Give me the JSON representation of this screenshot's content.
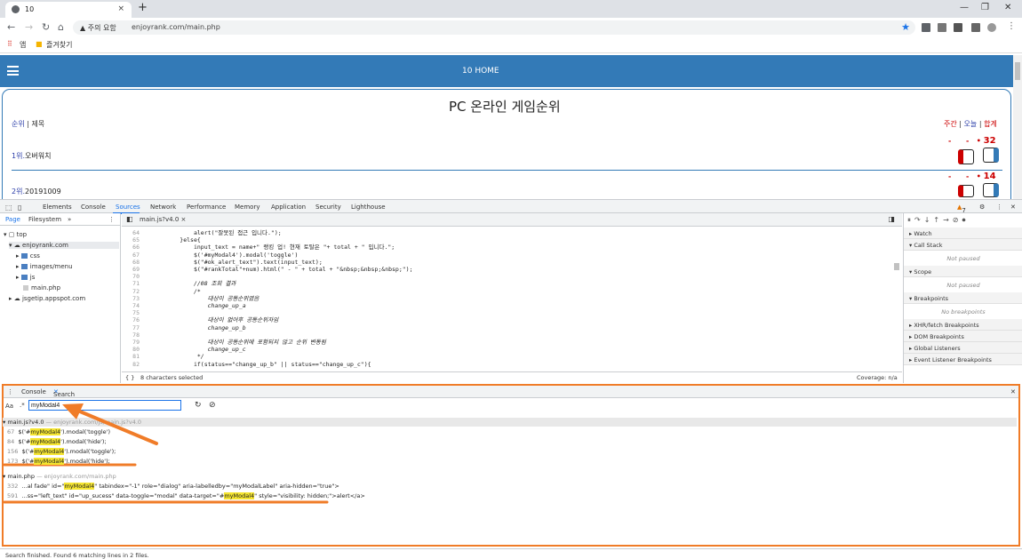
{
  "browser": {
    "tab_title": "10",
    "tab_close": "×",
    "new_tab": "+",
    "security_label": "주의 요함",
    "url": "enjoyrank.com/main.php",
    "bookmarks": [
      "앱",
      "즐겨찾기"
    ]
  },
  "page": {
    "header_title": "10 HOME",
    "title": "PC 온라인 게임순위",
    "col_rank": "순위",
    "col_sep": "|",
    "col_title": "제목",
    "filter_weekly": "주간",
    "filter_today": "오늘",
    "filter_total": "합계",
    "rows": [
      {
        "rank": "1위.",
        "name": "오버워치",
        "up": "-",
        "mid": "-",
        "total": "32"
      },
      {
        "rank": "2위.",
        "name": "20191009",
        "up": "-",
        "mid": "-",
        "total": "14"
      }
    ]
  },
  "devtools": {
    "tabs": [
      "Elements",
      "Console",
      "Sources",
      "Network",
      "Performance",
      "Memory",
      "Application",
      "Security",
      "Lighthouse"
    ],
    "active_tab": "Sources",
    "warning_count": "7",
    "nav_tabs": [
      "Page",
      "Filesystem"
    ],
    "tree": [
      "top",
      "enjoyrank.com",
      "css",
      "images/menu",
      "js",
      "main.php",
      "jsgetip.appspot.com"
    ],
    "editor_file": "main.js?v4.0",
    "code_lines": [
      {
        "n": "64",
        "t": "            alert(\"잘못된 접근 입니다.\");"
      },
      {
        "n": "65",
        "t": "        }else{"
      },
      {
        "n": "66",
        "t": "            input_text = name+\" 랭킹 업! 현재 토탈은 \"+ total + \" 입니다.\";"
      },
      {
        "n": "67",
        "t": "            $('#myModal4').modal('toggle')"
      },
      {
        "n": "68",
        "t": "            $(\"#ok_alert_text\").text(input_text);"
      },
      {
        "n": "69",
        "t": "            $(\"#rankTotal\"+num).html(\" - \" + total + \"&nbsp;&nbsp;&nbsp;\");"
      },
      {
        "n": "70",
        "t": ""
      },
      {
        "n": "71",
        "t": "            //08 조회 결과"
      },
      {
        "n": "72",
        "t": "            /*"
      },
      {
        "n": "73",
        "t": "                대상이 공동순위였음"
      },
      {
        "n": "74",
        "t": "                change_up_a"
      },
      {
        "n": "75",
        "t": ""
      },
      {
        "n": "76",
        "t": "                대상이 없어후 공동순위자임"
      },
      {
        "n": "77",
        "t": "                change_up_b"
      },
      {
        "n": "78",
        "t": ""
      },
      {
        "n": "79",
        "t": "                대상이 공동순위에 포함되지 않고 순위 변동됨"
      },
      {
        "n": "80",
        "t": "                change_up_c"
      },
      {
        "n": "81",
        "t": "             */"
      },
      {
        "n": "82",
        "t": "            if(status==\"change_up_b\" || status==\"change_up_c\"){"
      }
    ],
    "selection_status": "8 characters selected",
    "coverage": "Coverage: n/a",
    "debug_sections": [
      "Watch",
      "Call Stack",
      "Scope",
      "Breakpoints",
      "XHR/fetch Breakpoints",
      "DOM Breakpoints",
      "Global Listeners",
      "Event Listener Breakpoints"
    ],
    "not_paused": "Not paused",
    "no_breakpoints": "No breakpoints"
  },
  "drawer": {
    "tabs": [
      "Console",
      "Search"
    ],
    "search_value": "myModal4",
    "aa": "Aa",
    "regex": ".*",
    "file1": "main.js?v4.0",
    "file1_path": "— enjoyrank.com/js/main.js?v4.0",
    "file1_results": [
      {
        "line": "67",
        "pre": "$('#",
        "match": "myModal4",
        "post": "').modal('toggle')"
      },
      {
        "line": "84",
        "pre": "$('#",
        "match": "myModal4",
        "post": "').modal('hide');"
      },
      {
        "line": "156",
        "pre": "$('#",
        "match": "myModal4",
        "post": "').modal('toggle');"
      },
      {
        "line": "173",
        "pre": "$('#",
        "match": "myModal4",
        "post": "').modal('hide');"
      }
    ],
    "file2": "main.php",
    "file2_path": "— enjoyrank.com/main.php",
    "file2_results": [
      {
        "line": "332",
        "pre": "...al fade\" id=\"",
        "match": "myModal4",
        "post": "\" tabindex=\"-1\" role=\"dialog\" aria-labelledby=\"myModalLabel\" aria-hidden=\"true\">"
      },
      {
        "line": "591",
        "pre": "...ss=\"left_text\" id=\"up_sucess\" data-toggle=\"modal\" data-target=\"#",
        "match": "myModal4",
        "post": "\" style=\"visibility: hidden;\">alert</a>"
      }
    ],
    "status": "Search finished.  Found 6 matching lines in 2 files."
  },
  "colors": {
    "accent": "#337ab7",
    "annotation": "#f07c28",
    "highlight": "#f5e531"
  }
}
